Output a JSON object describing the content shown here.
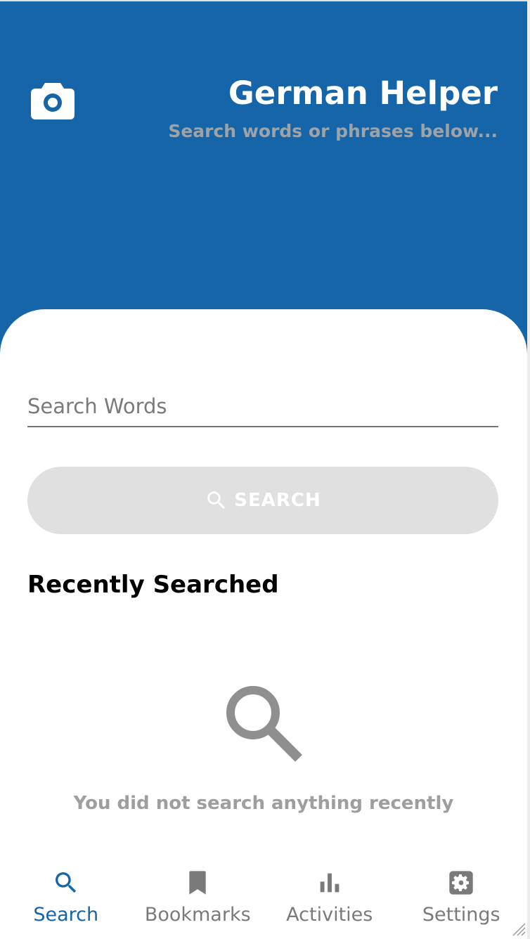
{
  "header": {
    "title": "German Helper",
    "subtitle": "Search words or phrases below...",
    "camera_icon": "camera-icon",
    "background": "#1565a8"
  },
  "search": {
    "placeholder": "Search Words",
    "value": "",
    "button_label": "SEARCH",
    "button_icon": "search-icon"
  },
  "recent": {
    "title": "Recently Searched",
    "empty_icon": "search-icon",
    "empty_message": "You did not search anything recently"
  },
  "nav": {
    "items": [
      {
        "label": "Search",
        "icon": "search-icon",
        "active": true
      },
      {
        "label": "Bookmarks",
        "icon": "bookmark-icon",
        "active": false
      },
      {
        "label": "Activities",
        "icon": "bar-chart-icon",
        "active": false
      },
      {
        "label": "Settings",
        "icon": "gear-icon",
        "active": false
      }
    ]
  },
  "colors": {
    "primary": "#1565a8",
    "muted": "#9e9e9e",
    "button_disabled": "#e0e0e0"
  }
}
